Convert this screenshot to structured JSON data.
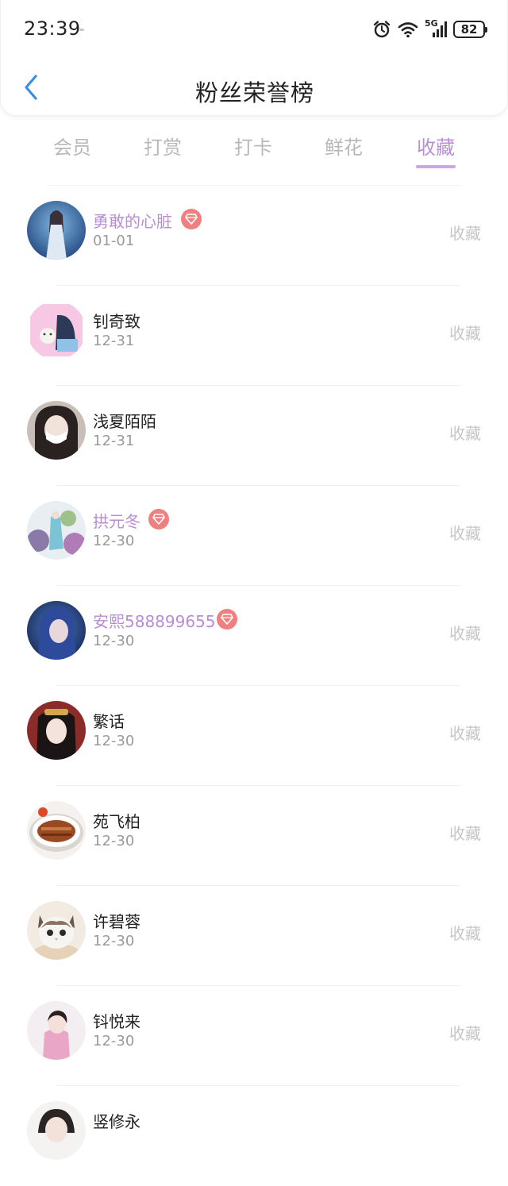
{
  "status_bar": {
    "time": "23:39",
    "network": "5G",
    "battery": "82",
    "icons": [
      "alarm-icon",
      "wifi-icon",
      "cellular-5g-icon",
      "battery-icon"
    ]
  },
  "header": {
    "title": "粉丝荣誉榜",
    "back_icon": "chevron-left-icon"
  },
  "tabs": [
    {
      "label": "会员",
      "active": false
    },
    {
      "label": "打赏",
      "active": false
    },
    {
      "label": "打卡",
      "active": false
    },
    {
      "label": "鲜花",
      "active": false
    },
    {
      "label": "收藏",
      "active": true
    }
  ],
  "colors": {
    "accent": "#b88fd6",
    "vip_name": "#b98cd3",
    "badge": "#f08080",
    "back_arrow": "#3a8ee6"
  },
  "fans": [
    {
      "name": "勇敢的心脏",
      "date": "01-01",
      "tag": "收藏",
      "vip": true
    },
    {
      "name": "钊奇致",
      "date": "12-31",
      "tag": "收藏",
      "vip": false
    },
    {
      "name": "浅夏陌陌",
      "date": "12-31",
      "tag": "收藏",
      "vip": false
    },
    {
      "name": "拱元冬",
      "date": "12-30",
      "tag": "收藏",
      "vip": true
    },
    {
      "name": "安熙588899655",
      "date": "12-30",
      "tag": "收藏",
      "vip": true
    },
    {
      "name": "繁话",
      "date": "12-30",
      "tag": "收藏",
      "vip": false
    },
    {
      "name": "苑飞柏",
      "date": "12-30",
      "tag": "收藏",
      "vip": false
    },
    {
      "name": "许碧蓉",
      "date": "12-30",
      "tag": "收藏",
      "vip": false
    },
    {
      "name": "钭悦来",
      "date": "12-30",
      "tag": "收藏",
      "vip": false
    },
    {
      "name": "竖修永",
      "date": "",
      "tag": "",
      "vip": false
    }
  ]
}
